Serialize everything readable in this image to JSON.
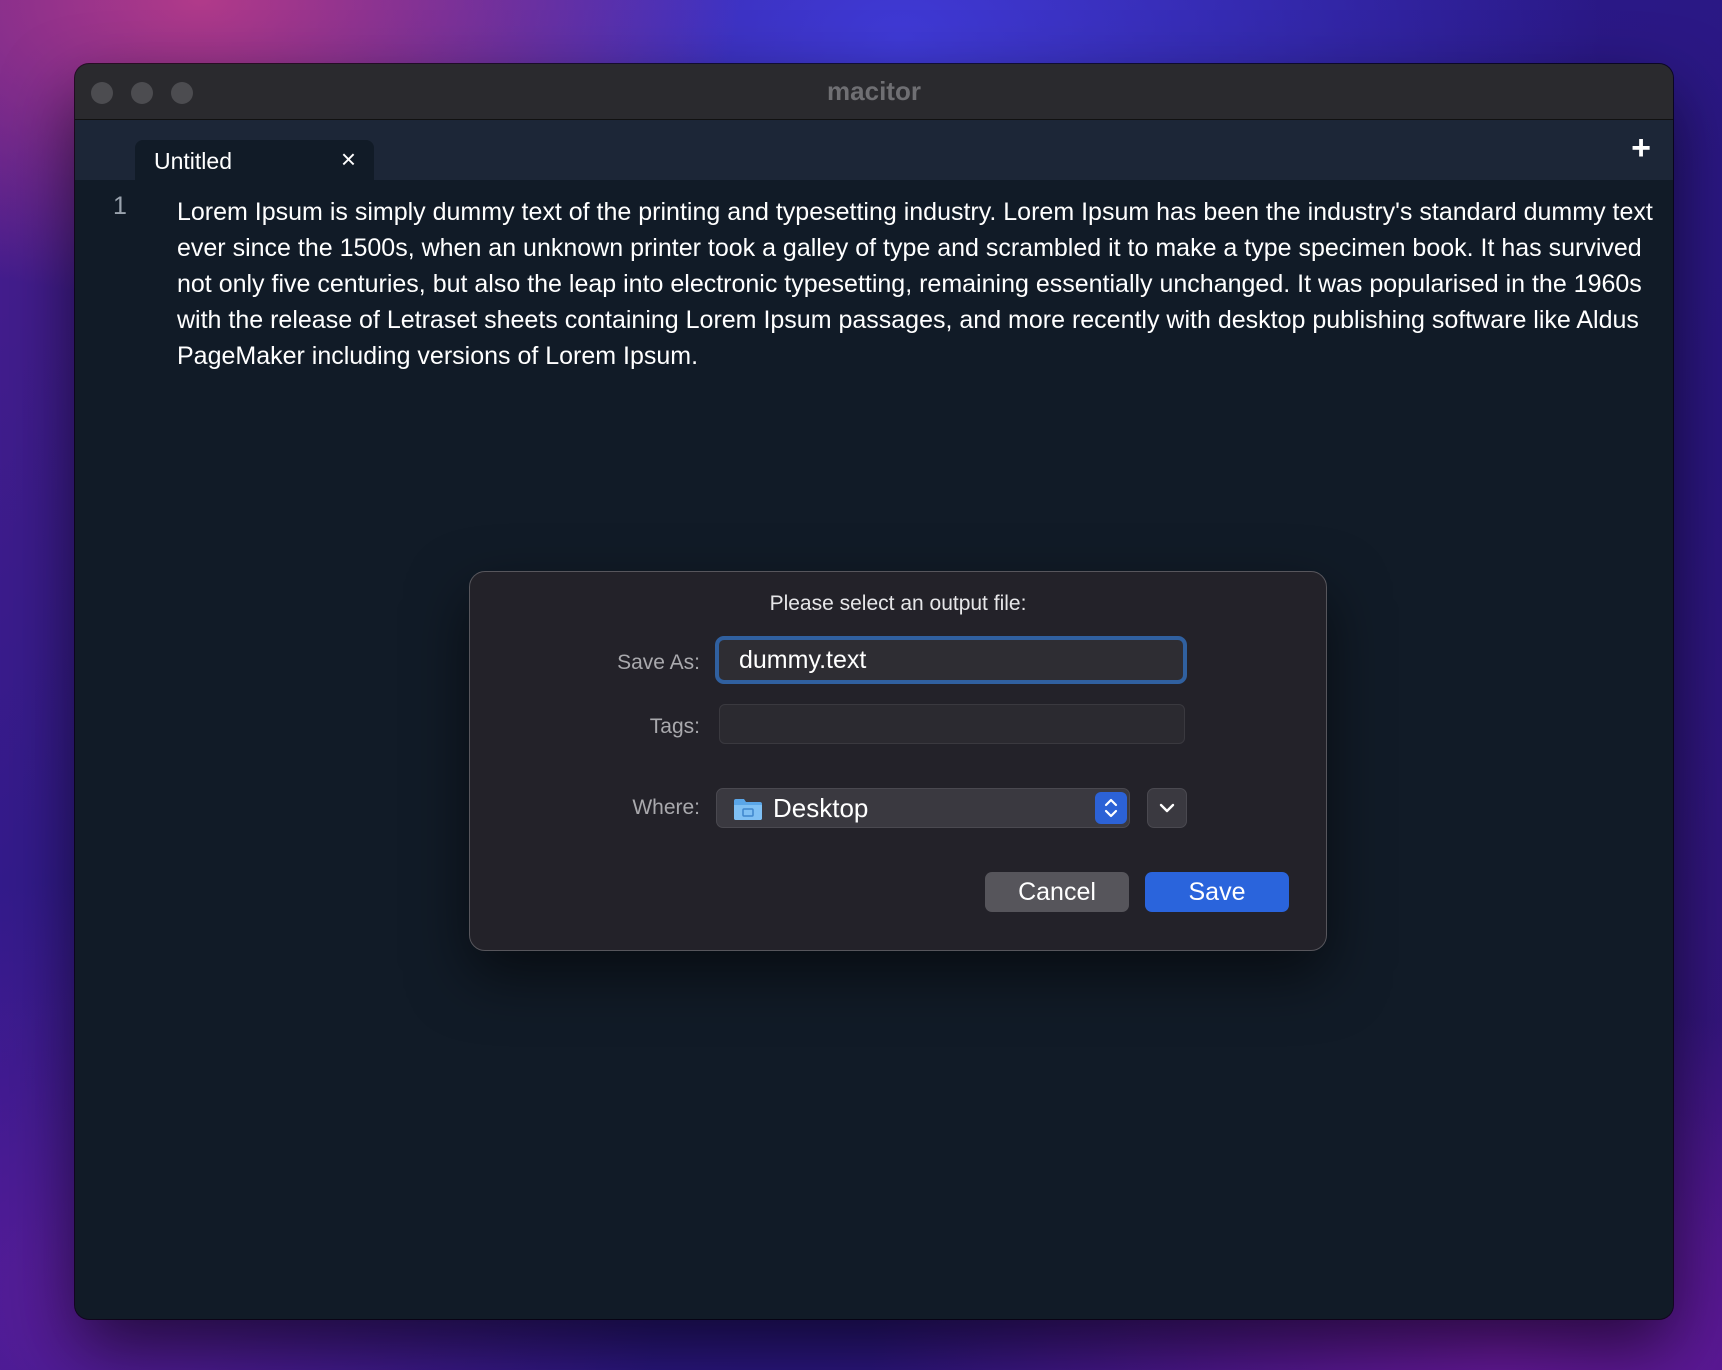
{
  "window": {
    "title": "macitor"
  },
  "tabs": [
    {
      "label": "Untitled",
      "close_icon": "close-icon"
    }
  ],
  "tabbar": {
    "add_icon": "plus-icon"
  },
  "editor": {
    "lines": [
      {
        "number": "1",
        "text": "Lorem Ipsum is simply dummy text of the printing and typesetting industry. Lorem Ipsum has been the industry's standard dummy text ever since the 1500s, when an unknown printer took a galley of type and scrambled it to make a type specimen book. It has survived not only five centuries, but also the leap into electronic typesetting, remaining essentially unchanged. It was popularised in the 1960s with the release of Letraset sheets containing Lorem Ipsum passages, and more recently with desktop publishing software like Aldus PageMaker including versions of Lorem Ipsum."
      }
    ]
  },
  "dialog": {
    "title": "Please select an output file:",
    "save_as_label": "Save As:",
    "save_as_value": "dummy.text",
    "tags_label": "Tags:",
    "tags_value": "",
    "where_label": "Where:",
    "where_value": "Desktop",
    "where_icon": "folder-icon",
    "cancel_label": "Cancel",
    "save_label": "Save"
  },
  "colors": {
    "accent": "#2a64dc",
    "focus_ring": "#30609f",
    "editor_bg": "#111b27",
    "tabbar_bg": "#1c2637"
  }
}
